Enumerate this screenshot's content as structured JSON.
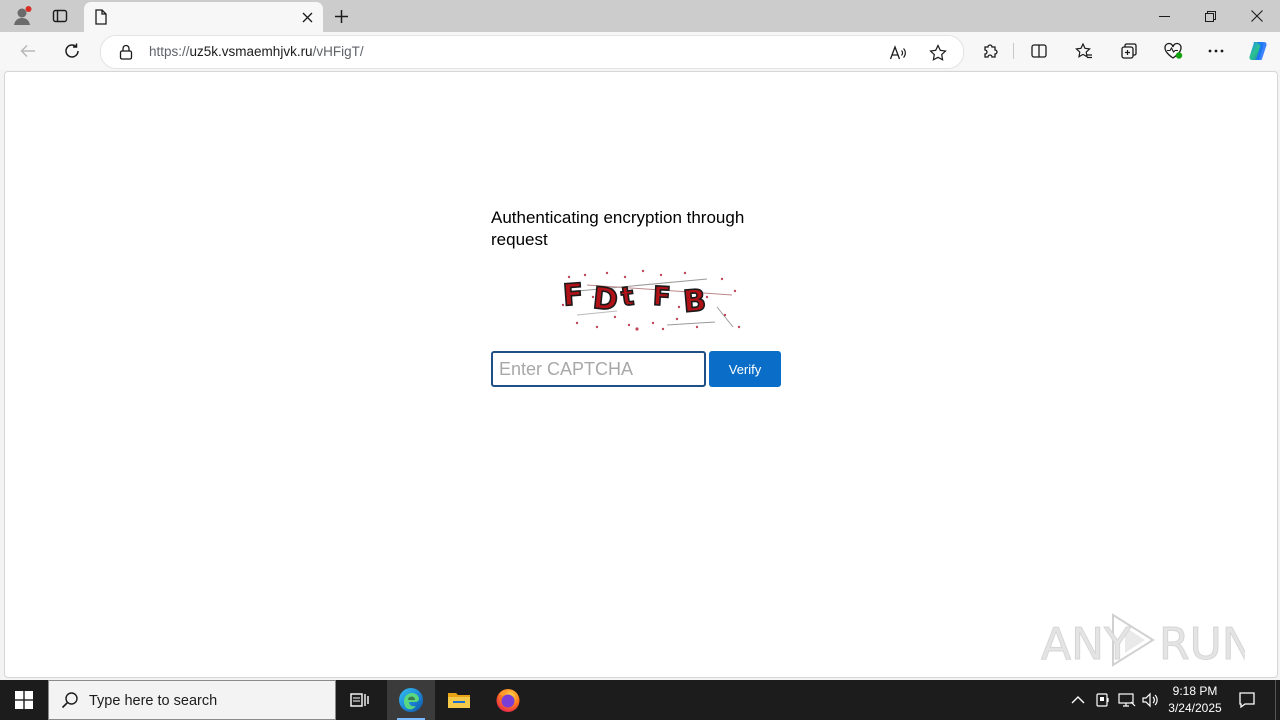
{
  "browser": {
    "tab_title": "",
    "url_prefix": "https://",
    "url_host": "uz5k.vsmaemhjvk.ru",
    "url_path": "/vHFigT/"
  },
  "page": {
    "heading": "Authenticating encryption through request",
    "captcha_text": "FDtFB",
    "input_value": "",
    "input_placeholder": "Enter CAPTCHA",
    "verify_label": "Verify"
  },
  "watermark": "ANY RUN",
  "taskbar": {
    "search_placeholder": "Type here to search",
    "time": "9:18 PM",
    "date": "3/24/2025"
  },
  "colors": {
    "accent": "#0a6ec8",
    "input_border": "#1e4f86",
    "captcha_red": "#b01218"
  }
}
